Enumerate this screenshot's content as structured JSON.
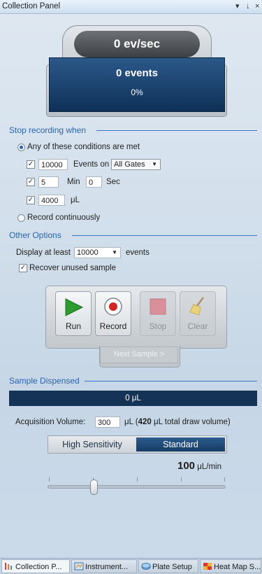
{
  "title_bar": {
    "title": "Collection Panel",
    "pin": "↓",
    "menu": "▾",
    "close": "×"
  },
  "counter": {
    "rate": "0 ev/sec",
    "events": "0 events",
    "percent": "0%"
  },
  "stop_recording": {
    "header": "Stop recording when",
    "option_conditions": "Any of these conditions are met",
    "events_value": "10000",
    "events_on_label": "Events on",
    "gate_select": "All Gates",
    "time_min_value": "5",
    "min_label": "Min",
    "time_sec_value": "0",
    "sec_label": "Sec",
    "volume_value": "4000",
    "volume_unit": "μL",
    "option_continuous": "Record continuously"
  },
  "other_options": {
    "header": "Other Options",
    "display_label": "Display at least",
    "display_select": "10000",
    "events_label": "events",
    "recover_label": "Recover unused sample"
  },
  "actions": {
    "run": "Run",
    "record": "Record",
    "stop": "Stop",
    "clear": "Clear",
    "next_sample": "Next Sample >"
  },
  "sample_dispensed": {
    "header": "Sample Dispensed",
    "value": "0 μL",
    "acq_label": "Acquisition Volume:",
    "acq_value": "300",
    "acq_unit_prefix": "μL (",
    "total_value": "420",
    "total_suffix": " μL total draw volume)",
    "mode_high": "High Sensitivity",
    "mode_standard": "Standard",
    "flow_value": "100",
    "flow_unit": " μL/min",
    "flow_slider_fraction": 0.25
  },
  "bottom_tabs": [
    "Collection P...",
    "Instrument...",
    "Plate Setup",
    "Heat Map S..."
  ]
}
